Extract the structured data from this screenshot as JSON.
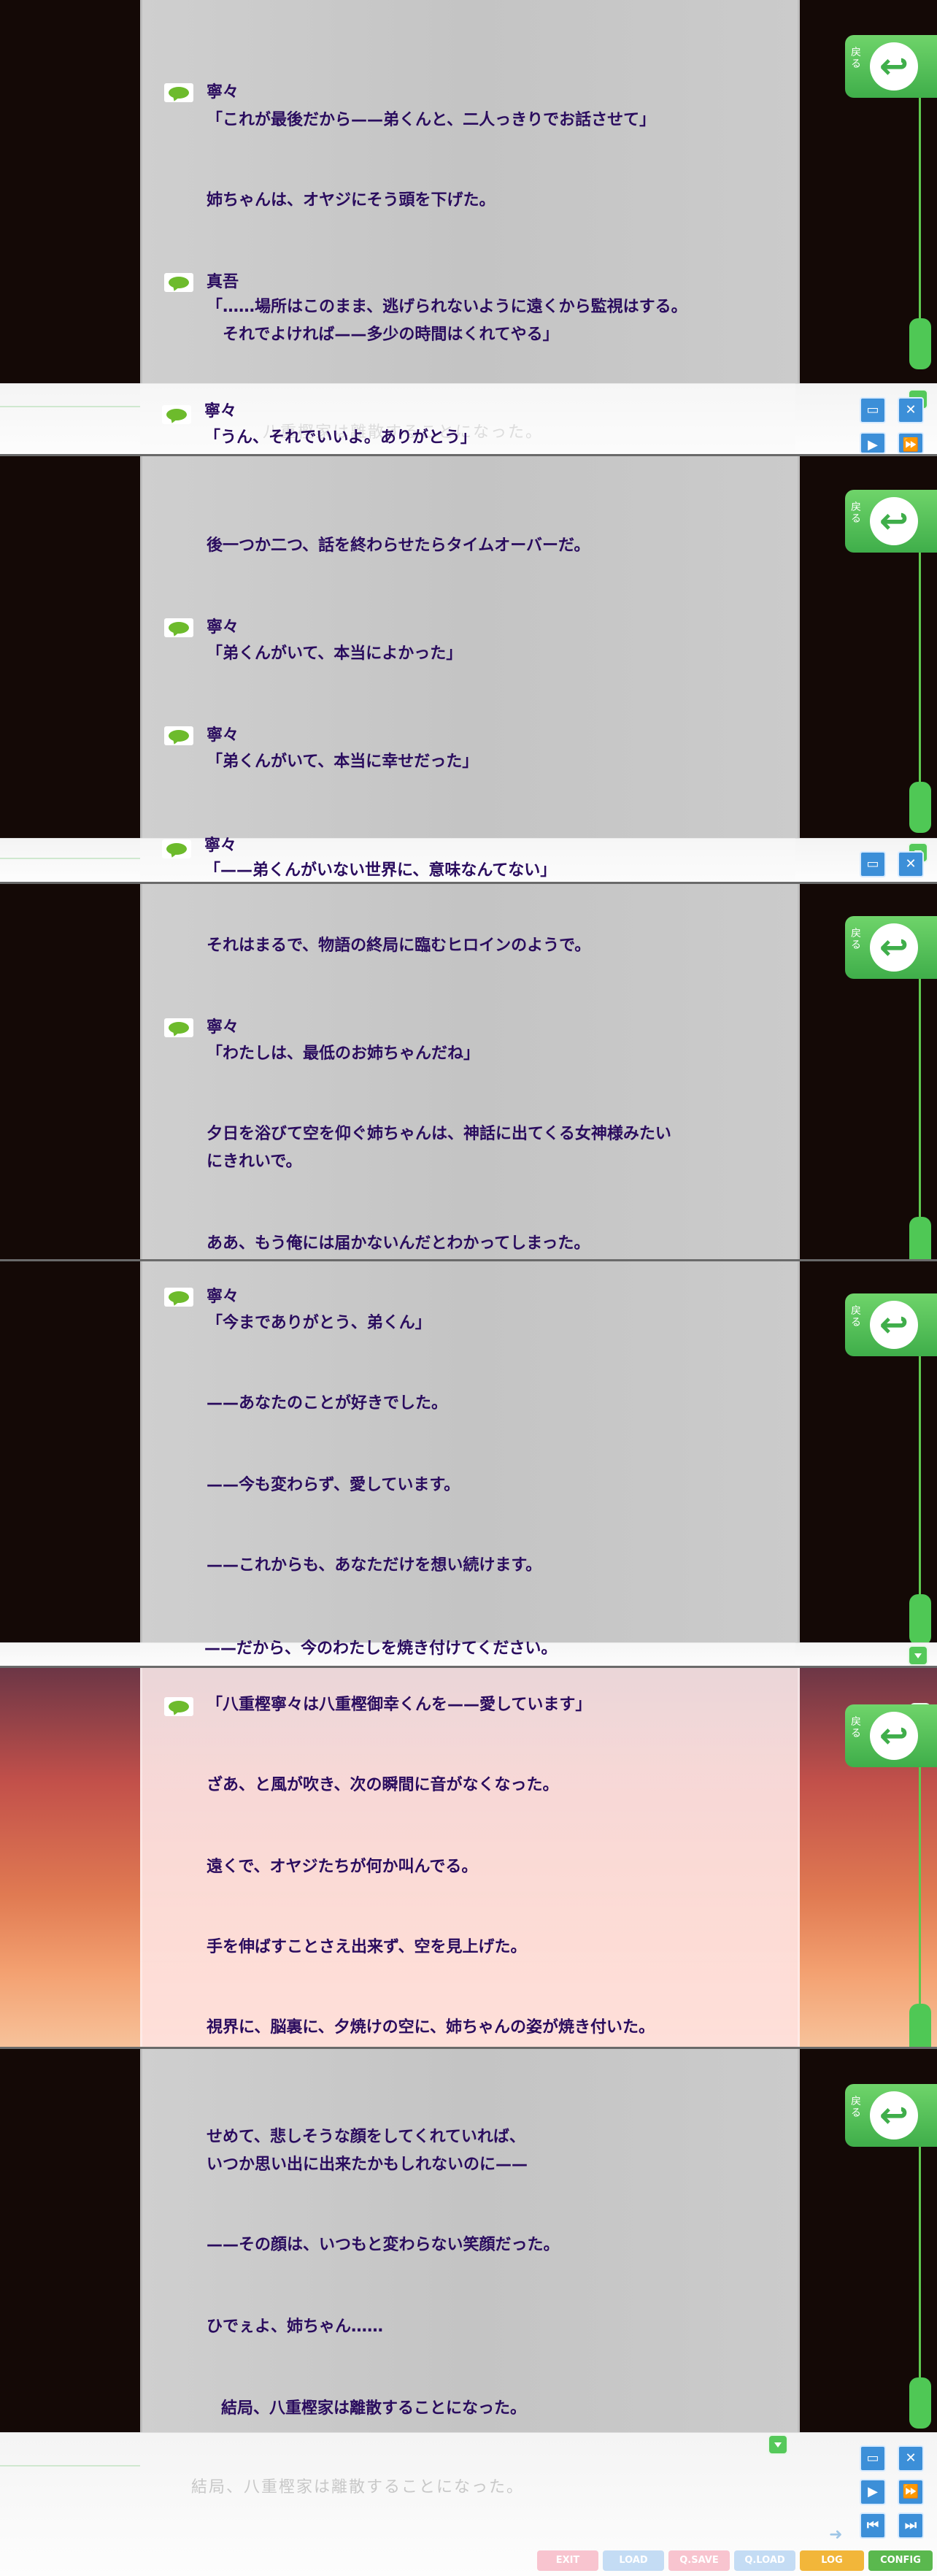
{
  "back_button": {
    "label": "戻る"
  },
  "message_window": {
    "current_text": "結局、八重樫家は離散することになった。"
  },
  "controls": {
    "window_icon": "window-icon",
    "close_icon": "close-icon",
    "play_icon": "play-icon",
    "skip_icon": "fast-forward-icon",
    "prev_icon": "previous-icon",
    "next_icon": "next-icon"
  },
  "menu": {
    "exit": "EXIT",
    "load": "LOAD",
    "qsave": "Q.SAVE",
    "qload": "Q.LOAD",
    "log": "LOG",
    "config": "CONFIG"
  },
  "colors": {
    "log_text": "#2a0c5e",
    "accent_green": "#55c95a",
    "control_blue": "#3c8fd8"
  },
  "panels": [
    {
      "entries": [
        {
          "speaker": "寧々",
          "text": "「これが最後だから——弟くんと、二人っきりでお話させて」"
        },
        {
          "speaker": "",
          "text": "姉ちゃんは、オヤジにそう頭を下げた。"
        },
        {
          "speaker": "真吾",
          "line1": "「……場所はこのまま、逃げられないように遠くから監視はする。",
          "line2": "　それでよければ——多少の時間はくれてやる」"
        },
        {
          "speaker": "寧々",
          "text": "「うん、それでいいよ。ありがとう」",
          "underlay": "八重樫家は離散することになった。"
        }
      ]
    },
    {
      "entries": [
        {
          "speaker": "",
          "text": "後一つか二つ、話を終わらせたらタイムオーバーだ。"
        },
        {
          "speaker": "寧々",
          "text": "「弟くんがいて、本当によかった」"
        },
        {
          "speaker": "寧々",
          "text": "「弟くんがいて、本当に幸せだった」"
        },
        {
          "speaker": "寧々",
          "text": "「——弟くんがいない世界に、意味なんてない」"
        }
      ]
    },
    {
      "entries": [
        {
          "speaker": "",
          "text": "それはまるで、物語の終局に臨むヒロインのようで。"
        },
        {
          "speaker": "寧々",
          "text": "「わたしは、最低のお姉ちゃんだね」"
        },
        {
          "speaker": "",
          "line1": "夕日を浴びて空を仰ぐ姉ちゃんは、神話に出てくる女神様みたい",
          "line2": "にきれいで。"
        },
        {
          "speaker": "",
          "text": "ああ、もう俺には届かないんだとわかってしまった。"
        }
      ]
    },
    {
      "entries": [
        {
          "speaker": "寧々",
          "text": "「今までありがとう、弟くん」"
        },
        {
          "speaker": "",
          "text": "——あなたのことが好きでした。"
        },
        {
          "speaker": "",
          "text": "——今も変わらず、愛しています。"
        },
        {
          "speaker": "",
          "text": "——これからも、あなただけを想い続けます。"
        },
        {
          "speaker": "",
          "text": "——だから、今のわたしを焼き付けてください。"
        }
      ]
    },
    {
      "entries": [
        {
          "speaker": "",
          "text": "「八重樫寧々は八重樫御幸くんを——愛しています」"
        },
        {
          "speaker": "",
          "text": "ざあ、と風が吹き、次の瞬間に音がなくなった。"
        },
        {
          "speaker": "",
          "text": "遠くで、オヤジたちが何か叫んでる。"
        },
        {
          "speaker": "",
          "text": "手を伸ばすことさえ出来ず、空を見上げた。"
        },
        {
          "speaker": "",
          "text": "視界に、脳裏に、夕焼けの空に、姉ちゃんの姿が焼き付いた。"
        }
      ]
    },
    {
      "entries": [
        {
          "speaker": "",
          "line1": "せめて、悲しそうな顔をしてくれていれば、",
          "line2": "いつか思い出に出来たかもしれないのに——"
        },
        {
          "speaker": "",
          "text": "——その顔は、いつもと変わらない笑顔だった。"
        },
        {
          "speaker": "",
          "text": "ひでぇよ、姉ちゃん……"
        },
        {
          "speaker": "",
          "text": "結局、八重樫家は離散することになった。"
        }
      ]
    }
  ]
}
